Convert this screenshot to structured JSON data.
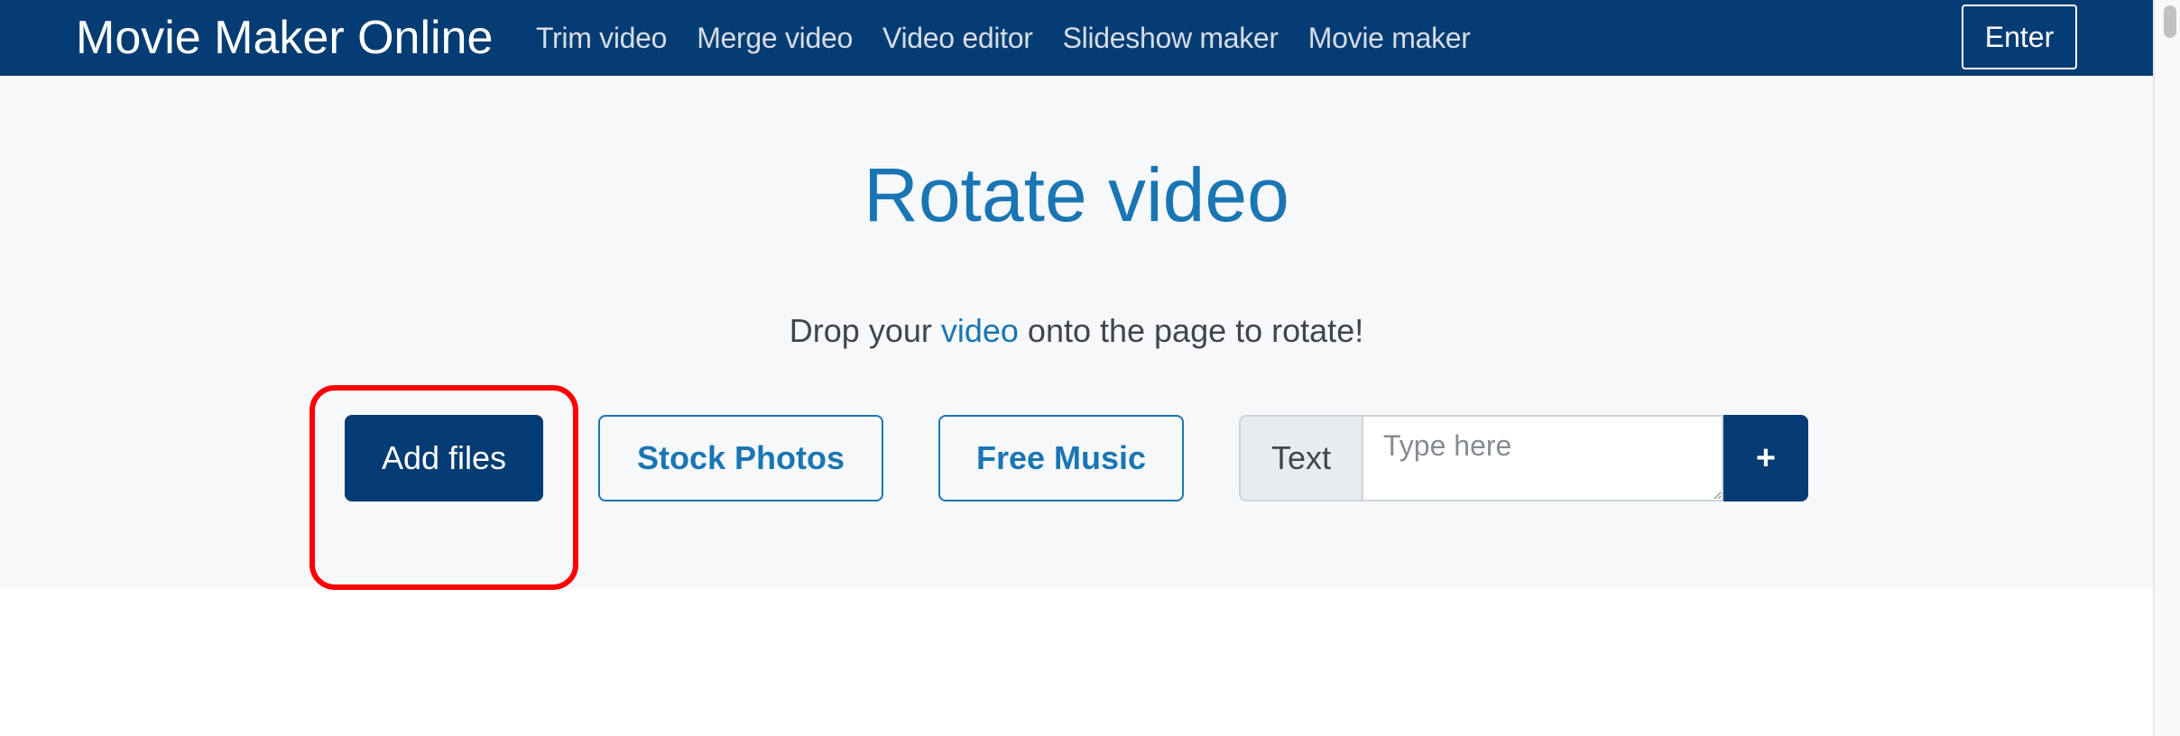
{
  "navbar": {
    "brand": "Movie Maker Online",
    "links": [
      {
        "label": "Trim video"
      },
      {
        "label": "Merge video"
      },
      {
        "label": "Video editor"
      },
      {
        "label": "Slideshow maker"
      },
      {
        "label": "Movie maker"
      }
    ],
    "enter_label": "Enter"
  },
  "hero": {
    "title": "Rotate video",
    "subtitle_before": "Drop your ",
    "subtitle_link": "video",
    "subtitle_after": " onto the page to rotate!"
  },
  "actions": {
    "add_files_label": "Add files",
    "stock_photos_label": "Stock Photos",
    "free_music_label": "Free Music",
    "text_addon_label": "Text",
    "text_input_value": "",
    "text_input_placeholder": "Type here",
    "add_text_label": "+"
  },
  "annotation": {
    "highlight_target": "add-files-button",
    "highlight_color": "#ff0000"
  },
  "colors": {
    "navbar_bg": "#053c73",
    "accent": "#1a76b3",
    "hero_bg": "#f7f8fa"
  }
}
